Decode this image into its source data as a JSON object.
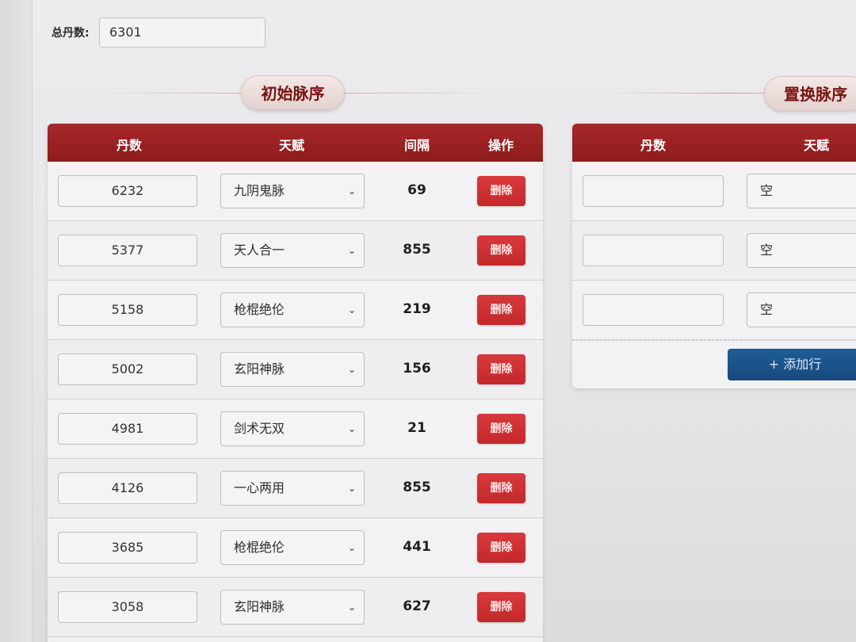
{
  "total": {
    "label": "总丹数:",
    "value": "6301"
  },
  "initial_section": {
    "title": "初始脉序",
    "columns": [
      "丹数",
      "天赋",
      "间隔",
      "操作"
    ],
    "rows": [
      {
        "pills": "6232",
        "talent": "九阴鬼脉",
        "interval": "69",
        "action": "删除"
      },
      {
        "pills": "5377",
        "talent": "天人合一",
        "interval": "855",
        "action": "删除"
      },
      {
        "pills": "5158",
        "talent": "枪棍绝伦",
        "interval": "219",
        "action": "删除"
      },
      {
        "pills": "5002",
        "talent": "玄阳神脉",
        "interval": "156",
        "action": "删除"
      },
      {
        "pills": "4981",
        "talent": "剑术无双",
        "interval": "21",
        "action": "删除"
      },
      {
        "pills": "4126",
        "talent": "一心两用",
        "interval": "855",
        "action": "删除"
      },
      {
        "pills": "3685",
        "talent": "枪棍绝伦",
        "interval": "441",
        "action": "删除"
      },
      {
        "pills": "3058",
        "talent": "玄阳神脉",
        "interval": "627",
        "action": "删除"
      }
    ]
  },
  "replace_section": {
    "title": "置换脉序",
    "columns": [
      "丹数",
      "天赋"
    ],
    "rows": [
      {
        "pills": "",
        "talent": "空"
      },
      {
        "pills": "",
        "talent": "空"
      },
      {
        "pills": "",
        "talent": "空"
      }
    ],
    "add_row_label": "+ 添加行"
  },
  "icons": {
    "chevron": "chevron-down-icon"
  },
  "colors": {
    "header_red": "#9b2224",
    "delete_red": "#d0302f",
    "add_blue": "#1b5489"
  }
}
